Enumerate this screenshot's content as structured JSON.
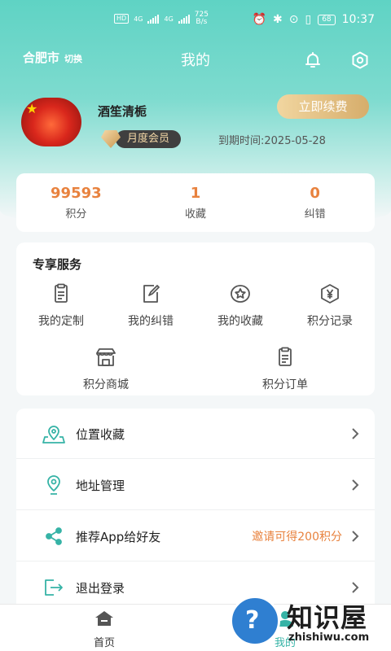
{
  "status_bar": {
    "hd": "HD",
    "net1": "4G",
    "net2": "4G",
    "speed_value": "725",
    "speed_unit": "B/s",
    "battery": "68",
    "time": "10:37"
  },
  "header": {
    "city": "合肥市",
    "city_switch": "切换",
    "title": "我的"
  },
  "profile": {
    "username": "酒笙清栀",
    "member_level": "月度会员",
    "expire_text": "到期时间:2025-05-28",
    "renew_label": "立即续费"
  },
  "stats": [
    {
      "value": "99593",
      "label": "积分"
    },
    {
      "value": "1",
      "label": "收藏"
    },
    {
      "value": "0",
      "label": "纠错"
    }
  ],
  "services": {
    "title": "专享服务",
    "items": [
      {
        "label": "我的定制",
        "icon": "clipboard-icon"
      },
      {
        "label": "我的纠错",
        "icon": "edit-icon"
      },
      {
        "label": "我的收藏",
        "icon": "star-badge-icon"
      },
      {
        "label": "积分记录",
        "icon": "yen-badge-icon"
      },
      {
        "label": "积分商城",
        "icon": "store-icon"
      },
      {
        "label": "积分订单",
        "icon": "order-icon"
      }
    ]
  },
  "menu": [
    {
      "label": "位置收藏",
      "extra": "",
      "icon": "map-pin-icon"
    },
    {
      "label": "地址管理",
      "extra": "",
      "icon": "location-icon"
    },
    {
      "label": "推荐App给好友",
      "extra": "邀请可得200积分",
      "icon": "share-icon"
    },
    {
      "label": "退出登录",
      "extra": "",
      "icon": "logout-icon"
    }
  ],
  "bottom_nav": {
    "home": "首页",
    "mine": "我的"
  },
  "watermark": {
    "cn": "知识屋",
    "en": "zhishiwu.com"
  },
  "colors": {
    "accent": "#36b3a6",
    "highlight": "#e8823e",
    "gold": "#d6ad6b"
  }
}
